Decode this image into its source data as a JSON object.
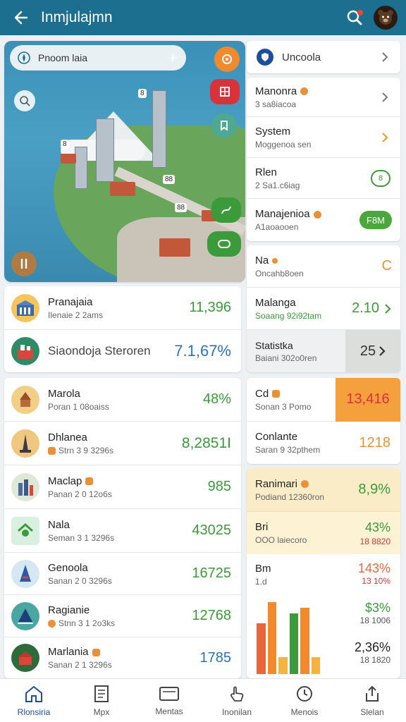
{
  "header": {
    "title": "Inmjulajmn"
  },
  "colors": {
    "primary": "#1d6f8f",
    "green": "#3b9a3a",
    "blue": "#2a73b8",
    "orange": "#f08a2c",
    "red": "#d8333a"
  },
  "map": {
    "search_label": "Pnoom laia",
    "pin_labels": [
      "8",
      "8",
      "88",
      "88"
    ],
    "buttons": [
      "orange-target",
      "red-layers",
      "teal-bookmark",
      "green-route",
      "green-share"
    ]
  },
  "left_top_list": [
    {
      "title": "Pranajaia",
      "subtitle": "Ilenaie 2 2ams",
      "value": "11,396"
    },
    {
      "title": "Siaondoja Steroren",
      "subtitle": "",
      "value": "7.1,67%"
    }
  ],
  "left_list": [
    {
      "title": "Marola",
      "subtitle": "Poran 1 08oaiss",
      "value": "48%"
    },
    {
      "title": "Dhlanea",
      "subtitle": "Strn 3 9 3296s",
      "value": "8,2851I"
    },
    {
      "title": "Maclap",
      "subtitle": "Panan 2 0 12o6s",
      "value": "985"
    },
    {
      "title": "Nala",
      "subtitle": "Seman 3 1 3296s",
      "value": "43025"
    },
    {
      "title": "Genoola",
      "subtitle": "Sanan 2 0 3296s",
      "value": "16725"
    },
    {
      "title": "Ragianie",
      "subtitle": "Stnn 3 1 2o3ks",
      "value": "12768"
    },
    {
      "title": "Marlania",
      "subtitle": "Sanan 2 1 3296s",
      "value": "1785"
    }
  ],
  "right_top": {
    "title": "Uncoola"
  },
  "right_list_1": [
    {
      "title": "Manonra",
      "subtitle": "3 sa8iacoa",
      "value": ""
    },
    {
      "title": "System",
      "subtitle": "Moggenoa sen",
      "value": ""
    },
    {
      "title": "Rlen",
      "subtitle": "2 Sa1.c6iag",
      "value": "8"
    },
    {
      "title": "Manajenioa",
      "subtitle": "A1aoaooen",
      "value": "F8M"
    }
  ],
  "right_list_2": [
    {
      "title": "Na",
      "subtitle": "Oncahb8oen",
      "value": "C"
    },
    {
      "title": "Malanga",
      "subtitle": "Soaang 92i92tam",
      "value": "2.10"
    },
    {
      "title": "Statistka",
      "subtitle": "Baiani 302o0ren",
      "value": "25"
    }
  ],
  "right_list_3": [
    {
      "title": "Cd",
      "subtitle": "Sonan 3 Pomo",
      "value": "13,416"
    },
    {
      "title": "Conlante",
      "subtitle": "Saran 9 32pthem",
      "value": "1218"
    }
  ],
  "right_list_4": [
    {
      "title": "Ranimari",
      "subtitle": "Podiand 12360ron",
      "value": "8,9%"
    },
    {
      "title": "Bri",
      "subtitle": "OOO laiecoro",
      "value": "43%",
      "value2": "18 8820"
    },
    {
      "title": "Bm",
      "subtitle": "1.d",
      "value": "143%",
      "value2": "13 10%"
    },
    {
      "title": "",
      "subtitle": "",
      "value": "$3%",
      "value2": "18 1006"
    },
    {
      "title": "",
      "subtitle": "",
      "value": "2,36%",
      "value2": "18 1820"
    }
  ],
  "chart_data": {
    "type": "bar",
    "categories": [
      "1",
      "2",
      "3",
      "4",
      "5",
      "6"
    ],
    "values": [
      60,
      85,
      20,
      72,
      78,
      20
    ],
    "colors": [
      "#e8663a",
      "#f08a2c",
      "#f4b443",
      "#3b9a3a",
      "#f08a2c",
      "#f4b443"
    ]
  },
  "bottom_nav": [
    {
      "label": "Rlonsiria",
      "icon": "home-icon"
    },
    {
      "label": "Mpx",
      "icon": "document-icon"
    },
    {
      "label": "Mentas",
      "icon": "tablet-icon"
    },
    {
      "label": "Inonilan",
      "icon": "touch-icon"
    },
    {
      "label": "Menois",
      "icon": "clock-icon"
    },
    {
      "label": "Slelan",
      "icon": "share-icon"
    }
  ]
}
